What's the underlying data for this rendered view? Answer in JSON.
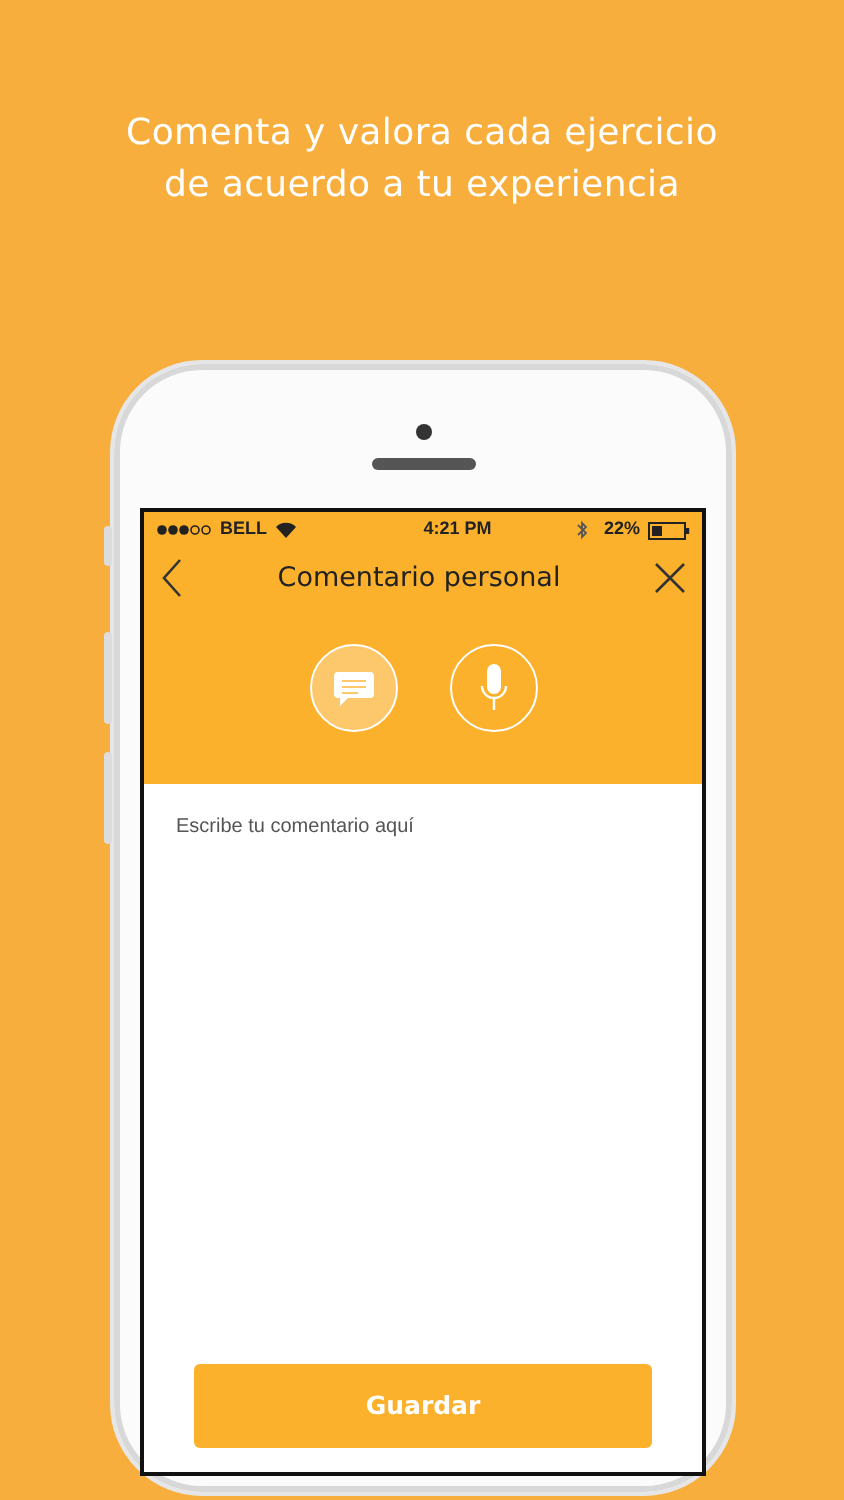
{
  "headline": "Comenta y valora cada ejercicio de acuerdo a tu experiencia",
  "status_bar": {
    "carrier": "BELL",
    "time": "4:21 PM",
    "battery": "22%"
  },
  "nav_bar": {
    "title": "Comentario personal"
  },
  "modes": [
    {
      "kind": "text",
      "selected": true
    },
    {
      "kind": "voice",
      "selected": false
    }
  ],
  "comment": {
    "placeholder": "Escribe tu comentario aquí"
  },
  "buttons": [
    "Guardar"
  ]
}
